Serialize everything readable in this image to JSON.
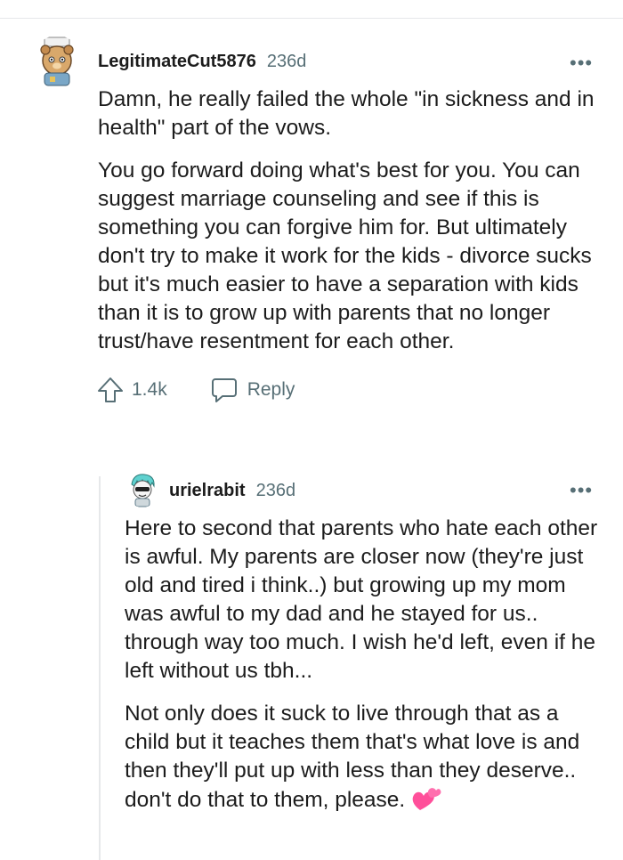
{
  "comments": [
    {
      "username": "LegitimateCut5876",
      "age": "236d",
      "more_icon": "more-horizontal-icon",
      "paragraphs": [
        "Damn, he really failed the whole \"in sickness and in health\" part of the vows.",
        "You go forward doing what's best for you. You can suggest marriage counseling and see if this is something you can forgive him for. But ultimately don't try to make it work for the kids - divorce sucks but it's much easier to have a separation with kids than it is to grow up with parents that no longer trust/have resentment for each other."
      ],
      "upvotes": "1.4k",
      "reply_label": "Reply"
    },
    {
      "username": "urielrabit",
      "age": "236d",
      "more_icon": "more-horizontal-icon",
      "paragraphs": [
        "Here to second that parents who hate each other is awful. My parents are closer now (they're just old and tired i think..) but growing up my mom was awful to my dad and he stayed for us.. through way too much. I wish he'd left, even if he left without us tbh...",
        "Not only does it suck to live through that as a child but it teaches them that's what love is and then they'll put up with less than they deserve.. don't do that to them, please."
      ],
      "trailing_emoji": "💕"
    }
  ],
  "colors": {
    "text": "#1c1c1c",
    "meta": "#576f76",
    "divider": "#e6e8ea"
  }
}
